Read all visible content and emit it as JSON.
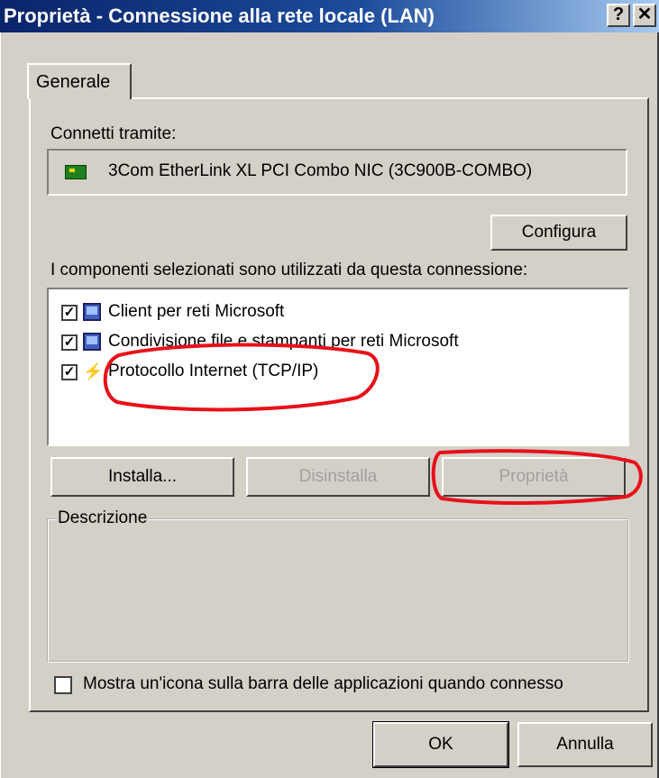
{
  "window": {
    "title": "Proprietà - Connessione alla rete locale (LAN)",
    "help_label": "?",
    "close_label": "✕"
  },
  "tabs": [
    {
      "label": "Generale",
      "selected": true
    }
  ],
  "connect": {
    "label": "Connetti tramite:",
    "adapter": "3Com EtherLink XL PCI Combo NIC (3C900B-COMBO)",
    "configure_label": "Configura"
  },
  "components": {
    "label": "I componenti selezionati sono utilizzati da questa connessione:",
    "items": [
      {
        "label": "Client per reti Microsoft",
        "checked": true,
        "icon": "computer-icon"
      },
      {
        "label": "Condivisione file e stampanti per reti Microsoft",
        "checked": true,
        "icon": "computer-icon"
      },
      {
        "label": "Protocollo Internet (TCP/IP)",
        "checked": true,
        "icon": "network-protocol-icon"
      }
    ]
  },
  "buttons": {
    "install": "Installa...",
    "uninstall": "Disinstalla",
    "properties": "Proprietà",
    "ok": "OK",
    "cancel": "Annulla"
  },
  "description": {
    "label": "Descrizione"
  },
  "show_icon": {
    "label": "Mostra un'icona sulla barra delle applicazioni quando connesso",
    "checked": false
  },
  "annotation_color": "#e8101a"
}
